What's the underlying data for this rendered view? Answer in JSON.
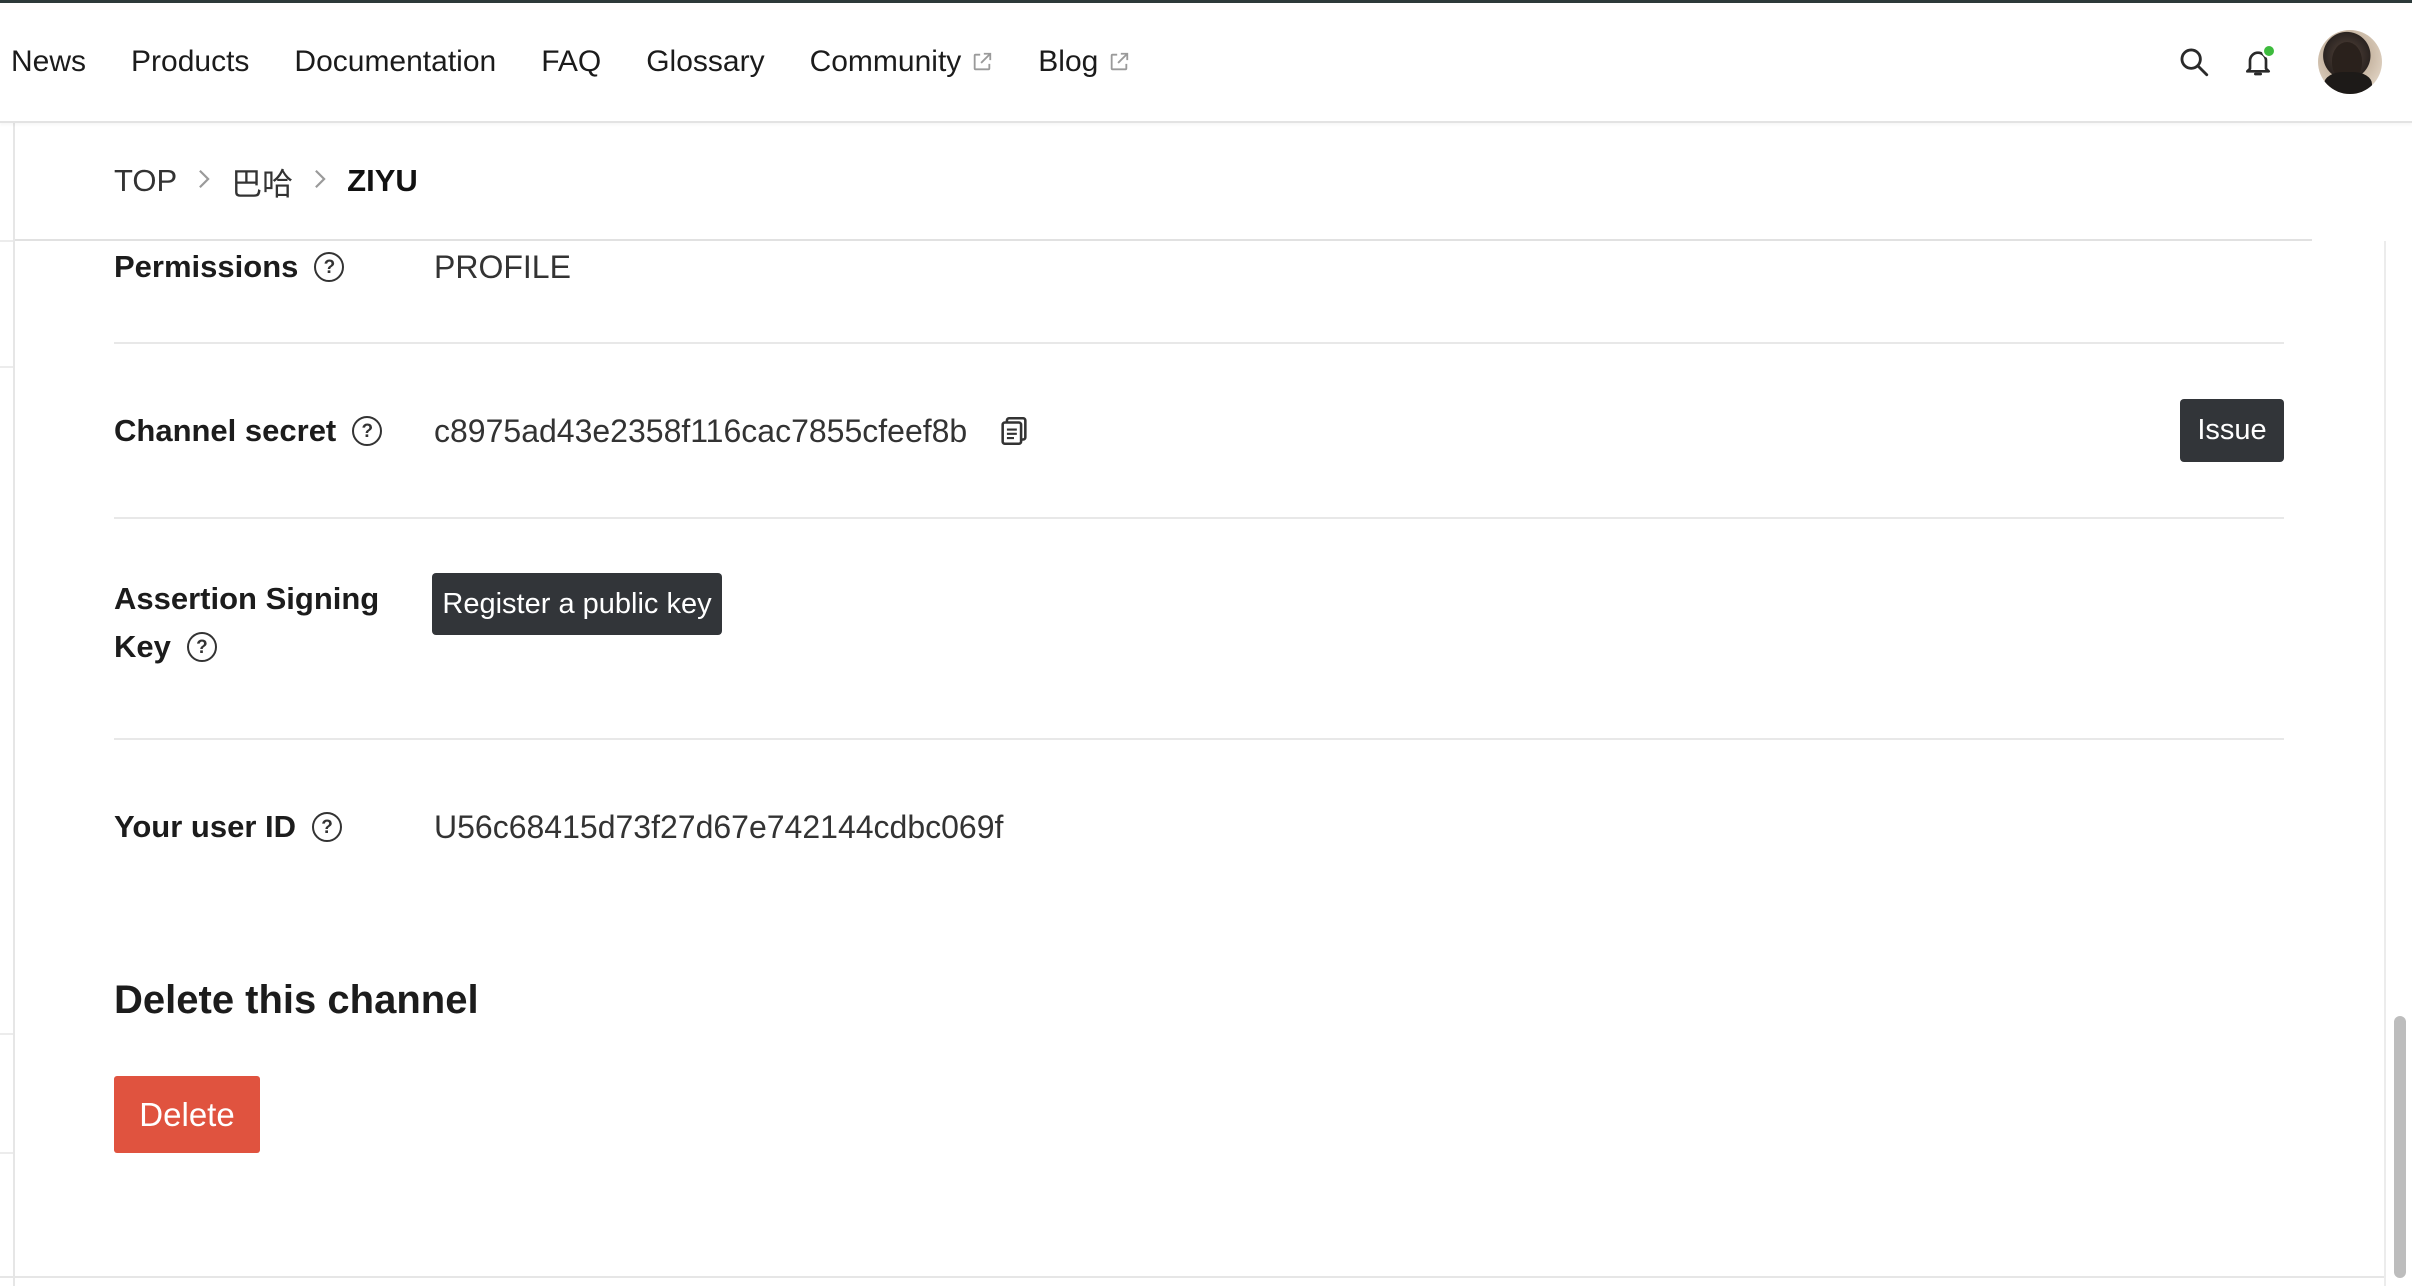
{
  "nav": {
    "items": [
      {
        "label": "News",
        "external": false
      },
      {
        "label": "Products",
        "external": false
      },
      {
        "label": "Documentation",
        "external": false
      },
      {
        "label": "FAQ",
        "external": false
      },
      {
        "label": "Glossary",
        "external": false
      },
      {
        "label": "Community",
        "external": true
      },
      {
        "label": "Blog",
        "external": true
      }
    ]
  },
  "header": {
    "search_icon": "search-icon",
    "bell_icon": "bell-icon",
    "notification_dot_color": "#3dbb3d"
  },
  "breadcrumb": {
    "items": [
      "TOP",
      "巴哈",
      "ZIYU"
    ],
    "separator": ">"
  },
  "settings": {
    "permissions": {
      "label": "Permissions",
      "help": "?",
      "value": "PROFILE"
    },
    "channel_secret": {
      "label": "Channel secret",
      "help": "?",
      "value": "c8975ad43e2358f116cac7855cfeef8b",
      "issue_label": "Issue"
    },
    "assertion_key": {
      "label_line1": "Assertion Signing",
      "label_line2": "Key",
      "help": "?",
      "register_label": "Register a public key"
    },
    "user_id": {
      "label": "Your user ID",
      "help": "?",
      "value": "U56c68415d73f27d67e742144cdbc069f"
    }
  },
  "delete_section": {
    "title": "Delete this channel",
    "button_label": "Delete",
    "button_color": "#e0533f"
  }
}
